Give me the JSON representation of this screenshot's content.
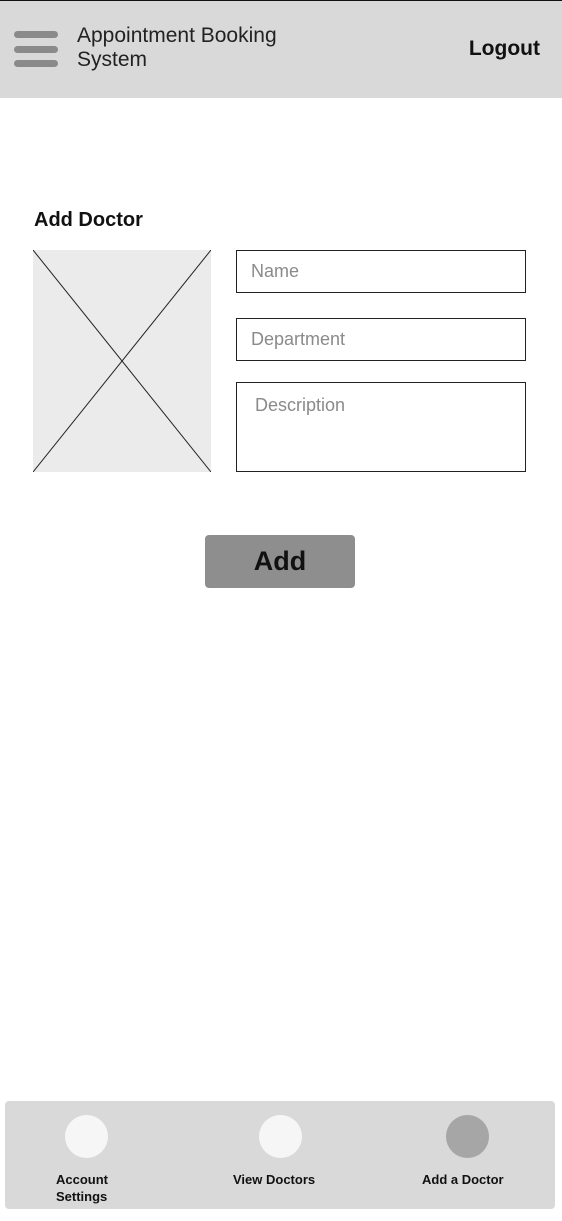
{
  "header": {
    "title": "Appointment Booking System",
    "menu_icon": "hamburger-menu-icon",
    "logout_label": "Logout"
  },
  "form": {
    "title": "Add Doctor",
    "image_placeholder_icon": "image-placeholder-x",
    "name_placeholder": "Name",
    "department_placeholder": "Department",
    "description_placeholder": "Description",
    "submit_label": "Add"
  },
  "bottom_nav": {
    "items": [
      {
        "label": "Account Settings",
        "icon": "circle-icon",
        "active": false
      },
      {
        "label": "View Doctors",
        "icon": "circle-icon",
        "active": false
      },
      {
        "label": "Add a Doctor",
        "icon": "circle-icon",
        "active": true
      }
    ]
  },
  "colors": {
    "header_bg": "#d9d9d9",
    "button_bg": "#8e8e8e",
    "active_nav_circle": "#a6a6a6",
    "inactive_nav_circle": "#f6f6f6"
  }
}
